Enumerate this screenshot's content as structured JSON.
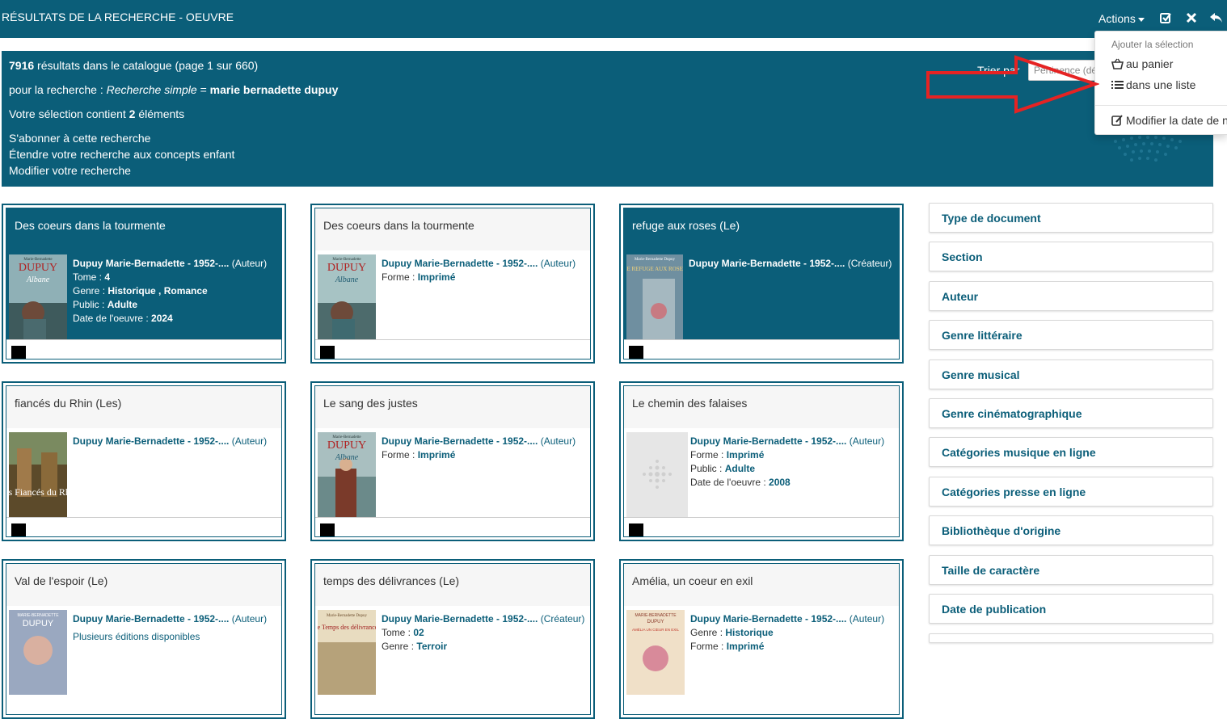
{
  "page_title": "RÉSULTATS DE LA RECHERCHE - OEUVRE",
  "header": {
    "actions_label": "Actions",
    "icons": [
      "check-square-icon",
      "close-icon",
      "back-arrow-icon"
    ]
  },
  "summary": {
    "count": "7916",
    "count_rest": "résultats dans le catalogue (page 1 sur 660)",
    "search_prefix": "pour la recherche : ",
    "search_type": "Recherche simple",
    "search_eq": " = ",
    "search_query": "marie bernadette dupuy",
    "selection_prefix": "Votre sélection contient ",
    "selection_count": "2",
    "selection_suffix": " éléments",
    "links": [
      "S'abonner à cette recherche",
      "Étendre votre recherche aux concepts enfant",
      "Modifier votre recherche"
    ],
    "sort_label": "Trier par",
    "sort_value": "Pertinence (dé"
  },
  "dropdown": {
    "header": "Ajouter la sélection",
    "items": [
      {
        "label": "au panier",
        "icon": "basket-icon"
      },
      {
        "label": "dans une liste",
        "icon": "list-icon"
      },
      {
        "label": "Modifier la date de n",
        "icon": "edit-icon"
      }
    ]
  },
  "cards": [
    {
      "title": "Des coeurs dans la tourmente",
      "author": "Dupuy Marie-Bernadette - 1952-....",
      "role": "(Auteur)",
      "lines": [
        {
          "label": "Tome",
          "value": "4"
        },
        {
          "label": "Genre",
          "value": "Historique , Romance"
        },
        {
          "label": "Public",
          "value": "Adulte"
        },
        {
          "label": "Date de l'oeuvre",
          "value": "2024"
        }
      ],
      "cover": {
        "top": "Marie-Bernadette",
        "name": "DUPUY",
        "sub": "Albane"
      }
    },
    {
      "title": "Des coeurs dans la tourmente",
      "author": "Dupuy Marie-Bernadette - 1952-....",
      "role": "(Auteur)",
      "lines": [
        {
          "label": "Forme",
          "value": "Imprimé"
        }
      ],
      "cover": {
        "top": "Marie-Bernadette",
        "name": "DUPUY",
        "sub": "Albane"
      }
    },
    {
      "title": "refuge aux roses (Le)",
      "author": "Dupuy Marie-Bernadette - 1952-....",
      "role": "(Créateur)",
      "lines": [],
      "cover": {
        "top": "Marie-Bernadette Dupuy",
        "name": "LE REFUGE AUX ROSES",
        "sub": ""
      }
    },
    {
      "title": "fiancés du Rhin (Les)",
      "author": "Dupuy Marie-Bernadette - 1952-....",
      "role": "(Auteur)",
      "lines": [],
      "cover": {
        "top": "",
        "name": "Les Fiancés du Rhin",
        "sub": ""
      }
    },
    {
      "title": "Le sang des justes",
      "author": "Dupuy Marie-Bernadette - 1952-....",
      "role": "(Auteur)",
      "lines": [
        {
          "label": "Forme",
          "value": "Imprimé"
        }
      ],
      "cover": {
        "top": "Marie-Bernadette",
        "name": "DUPUY",
        "sub": "Albane"
      }
    },
    {
      "title": "Le chemin des falaises",
      "author": "Dupuy Marie-Bernadette - 1952-....",
      "role": "(Auteur)",
      "lines": [
        {
          "label": "Forme",
          "value": "Imprimé"
        },
        {
          "label": "Public",
          "value": "Adulte"
        },
        {
          "label": "Date de l'oeuvre",
          "value": "2008"
        }
      ],
      "cover": {
        "top": "",
        "name": "",
        "sub": ""
      }
    },
    {
      "title": "Val de l'espoir (Le)",
      "author": "Dupuy Marie-Bernadette - 1952-....",
      "role": "(Auteur)",
      "extra": "Plusieurs éditions disponibles",
      "lines": [],
      "cover": {
        "top": "MARIE-BERNADETTE",
        "name": "DUPUY",
        "sub": ""
      }
    },
    {
      "title": "temps des délivrances (Le)",
      "author": "Dupuy Marie-Bernadette - 1952-....",
      "role": "(Créateur)",
      "lines": [
        {
          "label": "Tome",
          "value": "02"
        },
        {
          "label": "Genre",
          "value": "Terroir"
        }
      ],
      "cover": {
        "top": "Marie-Bernadette Dupuy",
        "name": "Le Temps des délivrances",
        "sub": ""
      }
    },
    {
      "title": "Amélia, un coeur en exil",
      "author": "Dupuy Marie-Bernadette - 1952-....",
      "role": "(Auteur)",
      "lines": [
        {
          "label": "Genre",
          "value": "Historique"
        },
        {
          "label": "Forme",
          "value": "Imprimé"
        }
      ],
      "cover": {
        "top": "MARIE-BERNADETTE",
        "name": "DUPUY",
        "sub": "AMÉLIA UN CŒUR EN EXIL"
      }
    }
  ],
  "facets": [
    "Type de document",
    "Section",
    "Auteur",
    "Genre littéraire",
    "Genre musical",
    "Genre cinématographique",
    "Catégories musique en ligne",
    "Catégories presse en ligne",
    "Bibliothèque d'origine",
    "Taille de caractère",
    "Date de publication"
  ]
}
